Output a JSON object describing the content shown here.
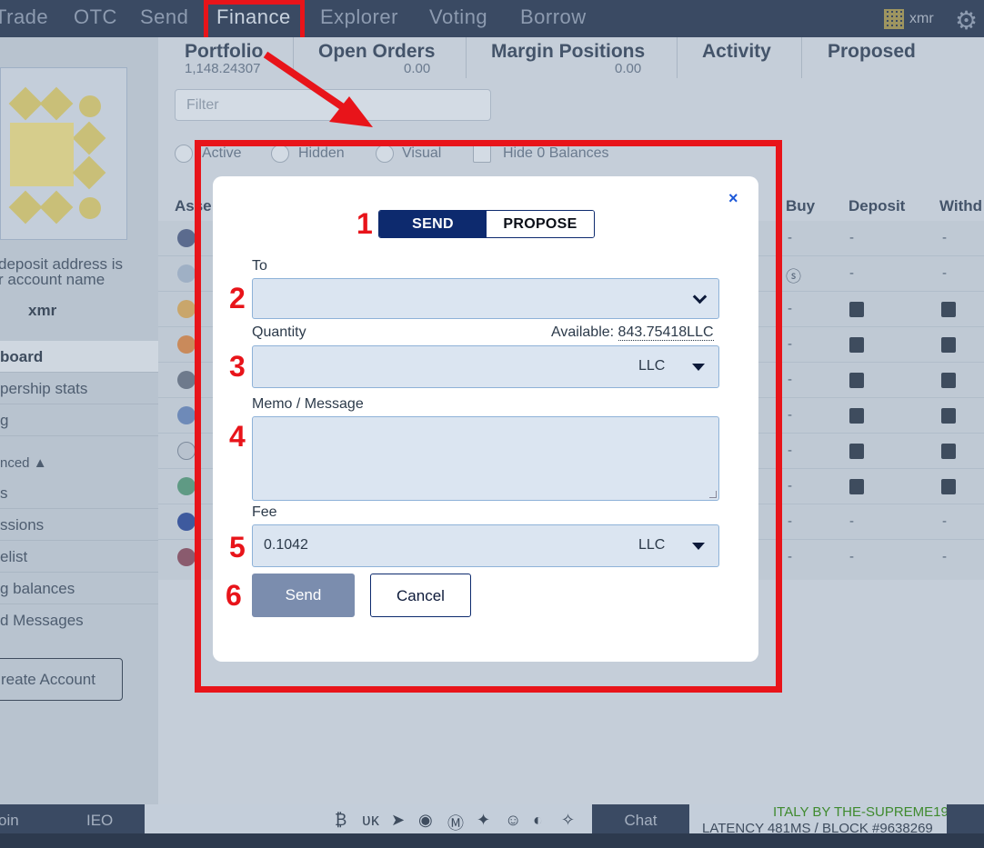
{
  "nav": {
    "items": [
      "Trade",
      "OTC",
      "Send",
      "Finance",
      "Explorer",
      "Voting",
      "Borrow"
    ],
    "account": "xmr"
  },
  "tabs": [
    {
      "label": "Portfolio",
      "sub": "1,148.24307"
    },
    {
      "label": "Open Orders",
      "sub": "0.00"
    },
    {
      "label": "Margin Positions",
      "sub": "0.00"
    },
    {
      "label": "Activity",
      "sub": ""
    },
    {
      "label": "Proposed",
      "sub": ""
    }
  ],
  "filter": {
    "placeholder": "Filter"
  },
  "radios": [
    "Active",
    "Hidden",
    "Visual"
  ],
  "hide_zero_label": "Hide 0 Balances",
  "columns": [
    "Asse",
    "Buy",
    "Deposit",
    "Withd"
  ],
  "sidebar": {
    "deposit_text_1": "deposit address is",
    "deposit_text_2": "r account name",
    "account": "xmr",
    "items": [
      "board",
      "pership stats",
      "g",
      "nced ▲",
      "s",
      "ssions",
      "elist",
      "g balances",
      "d Messages"
    ],
    "create_account": "reate Account"
  },
  "modal": {
    "mode_send": "SEND",
    "mode_propose": "PROPOSE",
    "close": "×",
    "to_label": "To",
    "to_value": "",
    "quantity_label": "Quantity",
    "available_label": "Available:",
    "available_value": "843.75418LLC",
    "quantity_asset": "LLC",
    "memo_label": "Memo / Message",
    "fee_label": "Fee",
    "fee_value": "0.1042",
    "fee_asset": "LLC",
    "send_button": "Send",
    "cancel_button": "Cancel"
  },
  "annotations": [
    "1",
    "2",
    "3",
    "4",
    "5",
    "6"
  ],
  "footer": {
    "left1": "oin",
    "left2": "IEO",
    "chat": "Chat",
    "node": "ITALY BY THE-SUPREME19",
    "latency": "LATENCY 481MS / BLOCK #9638269"
  },
  "colors": {
    "highlight": "#e8141a",
    "primary": "#0d2a6e",
    "nav": "#3a4a63"
  }
}
